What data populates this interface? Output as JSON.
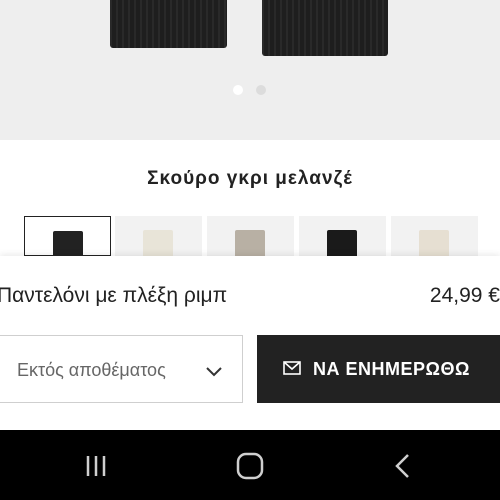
{
  "gallery": {
    "image_icon": "black-knit-trousers-image",
    "dots_count": 2,
    "active_dot": 1
  },
  "color_selector": {
    "selected_color_name": "Σκούρο γκρι μελανζέ",
    "swatches": [
      {
        "color": "#222222",
        "selected": true
      },
      {
        "color": "#e8e4d8",
        "selected": false
      },
      {
        "color": "#b8b0a4",
        "selected": false
      },
      {
        "color": "#1a1a1a",
        "selected": false
      },
      {
        "color": "#e6dfd2",
        "selected": false
      }
    ]
  },
  "product": {
    "title": "Παντελόνι με πλέξη ριμπ",
    "price": "24,99 €"
  },
  "size_select": {
    "value": "Εκτός αποθέματος",
    "icon": "chevron-down-icon"
  },
  "notify_button": {
    "label": "ΝΑ ΕΝΗΜΕΡΩΘΩ",
    "icon": "mail-icon"
  },
  "system_nav": {
    "recents_icon": "recents-icon",
    "home_icon": "home-icon",
    "back_icon": "back-icon"
  },
  "colors": {
    "button_bg": "#222222",
    "hero_bg": "#eeeeee",
    "nav_bg": "#000000"
  }
}
